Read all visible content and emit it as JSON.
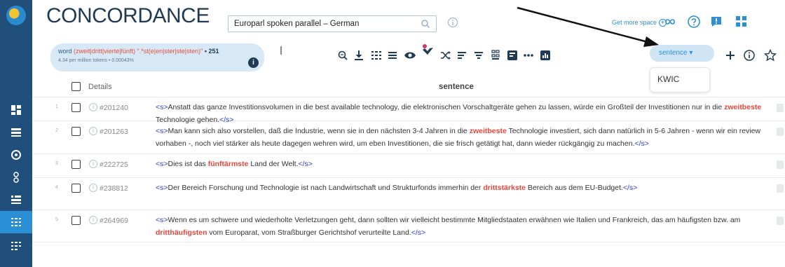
{
  "app": {
    "title": "CONCORDANCE"
  },
  "header": {
    "corpus_value": "Europarl spoken parallel – German",
    "get_more_space": "Get more space"
  },
  "query": {
    "prefix": "word ",
    "expr": "(zweit|dritt|vierte|fünft) \".*st(e|en|ster|ste|sten)\"",
    "count": "• 251",
    "stats": "4.34 per million tokens • 0.00043%"
  },
  "toolbar": {
    "view_select": "sentence ▾",
    "dropdown_option": "KWIC"
  },
  "table": {
    "col_details": "Details",
    "col_sentence": "sentence",
    "rows": [
      {
        "n": "1",
        "ref": "#201240",
        "before": "Anstatt das ganze Investitionsvolumen in die best available technology, die elektronischen Vorschaltgeräte gehen zu lassen, würde ein Großteil der Investitionen nur in die ",
        "kwic": "zweitbeste",
        "after": " Technologie gehen."
      },
      {
        "n": "2",
        "ref": "#201263",
        "before": "Man kann sich also vorstellen, daß die Industrie, wenn sie in den nächsten 3-4 Jahren in die ",
        "kwic": "zweitbeste",
        "after": " Technologie investiert, sich dann natürlich in 5-6 Jahren - wenn wir ein review vorhaben -, noch viel stärker als heute dagegen wehren wird, um eben Investitionen, die sie frisch getätigt hat, dann wieder rückgängig zu machen."
      },
      {
        "n": "3",
        "ref": "#222725",
        "before": "Dies ist das ",
        "kwic": "fünftärmste",
        "after": " Land der Welt."
      },
      {
        "n": "4",
        "ref": "#238812",
        "before": "Der Bereich Forschung und Technologie ist nach Landwirtschaft und Strukturfonds immerhin der ",
        "kwic": "drittstärkste",
        "after": " Bereich aus dem EU-Budget."
      },
      {
        "n": "5",
        "ref": "#264969",
        "before": "Wenn es um schwere und wiederholte Verletzungen geht, dann sollten wir vielleicht bestimmte Mitgliedstaaten erwähnen wie Italien und Frankreich, das am häufigsten bzw. am ",
        "kwic": "dritthäufigsten",
        "after": " vom Europarat, vom Straßburger Gerichtshof verurteilte Land."
      }
    ],
    "s_open": "<s>",
    "s_close": "</s>"
  },
  "colors": {
    "rail": "#1f4f7a",
    "accent": "#2d8fd5",
    "keyword": "#e8453a",
    "tag": "#2e3adf",
    "chip": "#d7e9f7"
  }
}
